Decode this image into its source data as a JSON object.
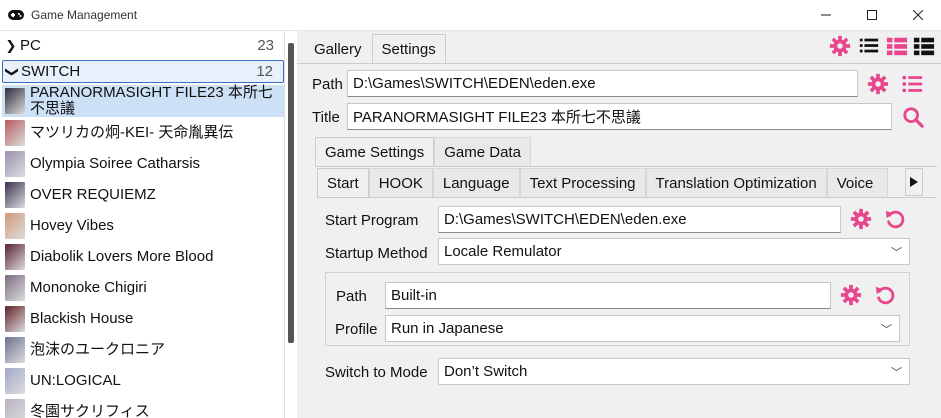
{
  "window": {
    "title": "Game Management"
  },
  "colors": {
    "accent": "#e8458c",
    "selection": "#cce0f6",
    "group_border": "#3a72c4"
  },
  "left_panel": {
    "groups": [
      {
        "label": "PC",
        "count": "23",
        "expanded": false
      },
      {
        "label": "SWITCH",
        "count": "12",
        "expanded": true
      }
    ],
    "games": [
      {
        "title": "PARANORMASIGHT FILE23 本所七不思議",
        "selected": true,
        "thumb": "#2b2b3a"
      },
      {
        "title": "マツリカの炯-KEI- 天命胤異伝",
        "selected": false,
        "thumb": "#b85a60"
      },
      {
        "title": "Olympia Soiree Catharsis",
        "selected": false,
        "thumb": "#9a8fb0"
      },
      {
        "title": "OVER REQUIEMZ",
        "selected": false,
        "thumb": "#3a3050"
      },
      {
        "title": "Hovey Vibes",
        "selected": false,
        "thumb": "#d09a7a"
      },
      {
        "title": "Diabolik Lovers More Blood",
        "selected": false,
        "thumb": "#5a2030"
      },
      {
        "title": "Mononoke Chigiri",
        "selected": false,
        "thumb": "#7a6a80"
      },
      {
        "title": "Blackish House",
        "selected": false,
        "thumb": "#602028"
      },
      {
        "title": "泡沫のユークロニア",
        "selected": false,
        "thumb": "#6a7090"
      },
      {
        "title": "UN:LOGICAL",
        "selected": false,
        "thumb": "#a0a8c8"
      },
      {
        "title": "冬園サクリフィス",
        "selected": false,
        "thumb": "#b8b0c0"
      }
    ]
  },
  "main_tabs": [
    {
      "label": "Gallery",
      "active": false
    },
    {
      "label": "Settings",
      "active": true
    }
  ],
  "toolbar_icons": [
    "gear-icon",
    "list-view-icon",
    "detail-list-icon",
    "grid-view-icon"
  ],
  "path_field": {
    "label": "Path",
    "value": "D:\\Games\\SWITCH\\EDEN\\eden.exe"
  },
  "title_field": {
    "label": "Title",
    "value": "PARANORMASIGHT FILE23 本所七不思議"
  },
  "sub_tabs": [
    {
      "label": "Game Settings",
      "active": true
    },
    {
      "label": "Game Data",
      "active": false
    }
  ],
  "inner_tabs": [
    {
      "label": "Start",
      "active": true
    },
    {
      "label": "HOOK",
      "active": false
    },
    {
      "label": "Language",
      "active": false
    },
    {
      "label": "Text Processing",
      "active": false
    },
    {
      "label": "Translation Optimization",
      "active": false
    },
    {
      "label": "Voice",
      "active": false
    }
  ],
  "start": {
    "program_label": "Start Program",
    "program_value": "D:\\Games\\SWITCH\\EDEN\\eden.exe",
    "method_label": "Startup Method",
    "method_value": "Locale Remulator",
    "inner_path_label": "Path",
    "inner_path_value": "Built-in",
    "profile_label": "Profile",
    "profile_value": "Run in Japanese",
    "switch_label": "Switch to Mode",
    "switch_value": "Don’t Switch"
  }
}
